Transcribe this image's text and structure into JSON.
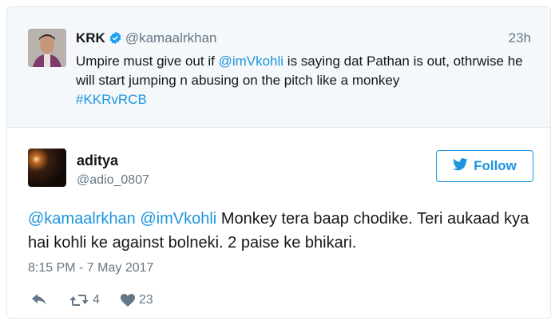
{
  "parent_tweet": {
    "name": "KRK",
    "handle": "@kamaalrkhan",
    "time": "23h",
    "text_1": "Umpire must give out if ",
    "mention": "@imVkohli",
    "text_2": " is saying dat Pathan is out, othrwise he will start jumping n abusing on the pitch like a monkey",
    "hashtag": "#KKRvRCB"
  },
  "tweet": {
    "name": "aditya",
    "handle": "@adio_0807",
    "follow_label": "Follow",
    "mention_1": "@kamaalrkhan",
    "mention_2": "@imVkohli",
    "text": "Monkey tera baap chodike. Teri aukaad kya hai kohli ke against bolneki. 2 paise ke bhikari.",
    "timestamp": "8:15 PM - 7 May 2017",
    "retweets": "4",
    "likes": "23"
  },
  "colors": {
    "link": "#1b95e0",
    "muted": "#657786",
    "verified": "#1da1f2"
  },
  "icons": [
    "verified-badge-icon",
    "bird-icon",
    "reply-icon",
    "retweet-icon",
    "heart-icon"
  ]
}
